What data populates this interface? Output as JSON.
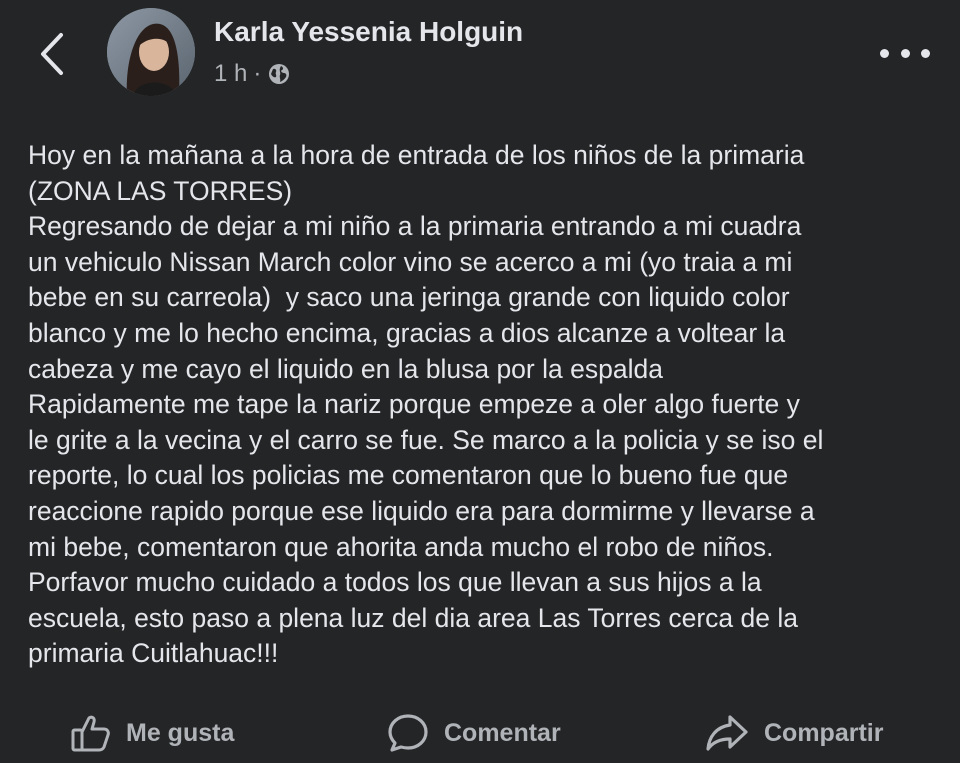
{
  "post": {
    "author": "Karla Yessenia Holguin",
    "time": "1 h",
    "separator": "·",
    "privacy_icon": "globe-icon",
    "lines": [
      "Hoy en la mañana a la hora de entrada de los niños de la primaria",
      "(ZONA LAS TORRES)",
      "Regresando de dejar a mi niño a la primaria entrando a mi cuadra",
      "un vehiculo Nissan March color vino se acerco a mi (yo traia a mi",
      "bebe en su carreola)  y saco una jeringa grande con liquido color",
      "blanco y me lo hecho encima, gracias a dios alcanze a voltear la",
      "cabeza y me cayo el liquido en la blusa por la espalda",
      "Rapidamente me tape la nariz porque empeze a oler algo fuerte y",
      "le grite a la vecina y el carro se fue. Se marco a la policia y se iso el",
      "reporte, lo cual los policias me comentaron que lo bueno fue que",
      "reaccione rapido porque ese liquido era para dormirme y llevarse a",
      "mi bebe, comentaron que ahorita anda mucho el robo de niños.",
      "Porfavor mucho cuidado a todos los que llevan a sus hijos a la",
      "escuela, esto paso a plena luz del dia area Las Torres cerca de la",
      "primaria Cuitlahuac!!!"
    ]
  },
  "actions": {
    "like_label": "Me gusta",
    "comment_label": "Comentar",
    "share_label": "Compartir"
  },
  "colors": {
    "background": "#242526",
    "primary_text": "#e4e6eb",
    "secondary_text": "#b0b3b8"
  }
}
